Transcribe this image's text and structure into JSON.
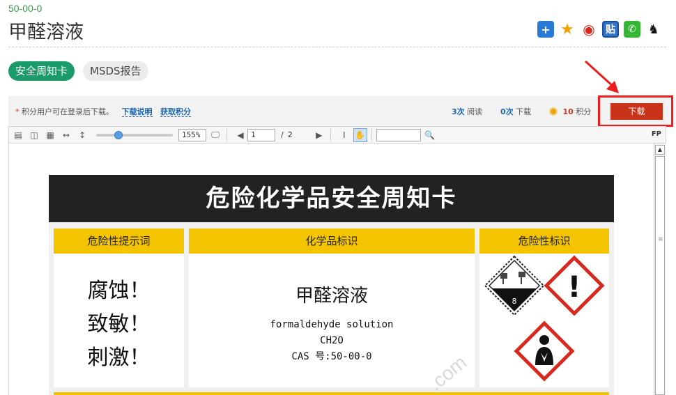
{
  "header": {
    "cas_number": "50-00-0",
    "title": "甲醛溶液",
    "share_icons": [
      "plus-icon",
      "star-icon",
      "weibo-icon",
      "tieba-icon",
      "wechat-icon",
      "qq-icon"
    ],
    "share_glyphs": {
      "plus": "+",
      "star": "★",
      "weibo": "◉",
      "tieba": "贴",
      "wechat": "✆",
      "qq": "♞"
    }
  },
  "tabs": [
    {
      "label": "安全周知卡",
      "active": true
    },
    {
      "label": "MSDS报告",
      "active": false
    }
  ],
  "infobar": {
    "note": "积分用户可在登录后下载。",
    "asterisk": "*",
    "link_help": "下载说明",
    "link_points": "获取积分",
    "reads_count": "3次",
    "reads_label": "阅读",
    "downloads_count": "0次",
    "downloads_label": "下载",
    "points_value": "10",
    "points_label": "积分",
    "download_button": "下载"
  },
  "toolbar": {
    "zoom": "155%",
    "page_current": "1",
    "page_separator": "/",
    "page_total": "2",
    "search_value": "",
    "fp_label": "FP",
    "glyphs": {
      "single": "▤",
      "double": "◫",
      "grid": "▦",
      "fit_width": "↔",
      "fit_height": "↕",
      "fullscreen": "🖵",
      "prev": "◀",
      "next": "▶",
      "text_select": "I",
      "hand": "✋",
      "search": "🔍",
      "scroll_up": "▲",
      "grip": "≡"
    }
  },
  "card": {
    "title": "危险化学品安全周知卡",
    "col_hazard_words_header": "危险性提示词",
    "hazard_words": [
      "腐蚀！",
      "致敏！",
      "刺激！"
    ],
    "col_chemical_header": "化学品标识",
    "chemical_name_cn": "甲醛溶液",
    "chemical_name_en": "formaldehyde solution",
    "formula": "CH2O",
    "cas_line": "CAS 号:50-00-0",
    "col_pictograms_header": "危险性标识",
    "pictograms": [
      "corrosive-class-8-icon",
      "exclamation-mark-icon",
      "health-hazard-icon"
    ],
    "class_8_label": "8",
    "exclamation_glyph": "!"
  },
  "watermark": ".com",
  "colors": {
    "accent_green": "#1a9b6a",
    "cas_green": "#3a9a4a",
    "download_red": "#c8331a",
    "highlight_red": "#ee1c1c",
    "ghs_yellow": "#f5c400",
    "ghs_red": "#d9281e"
  }
}
